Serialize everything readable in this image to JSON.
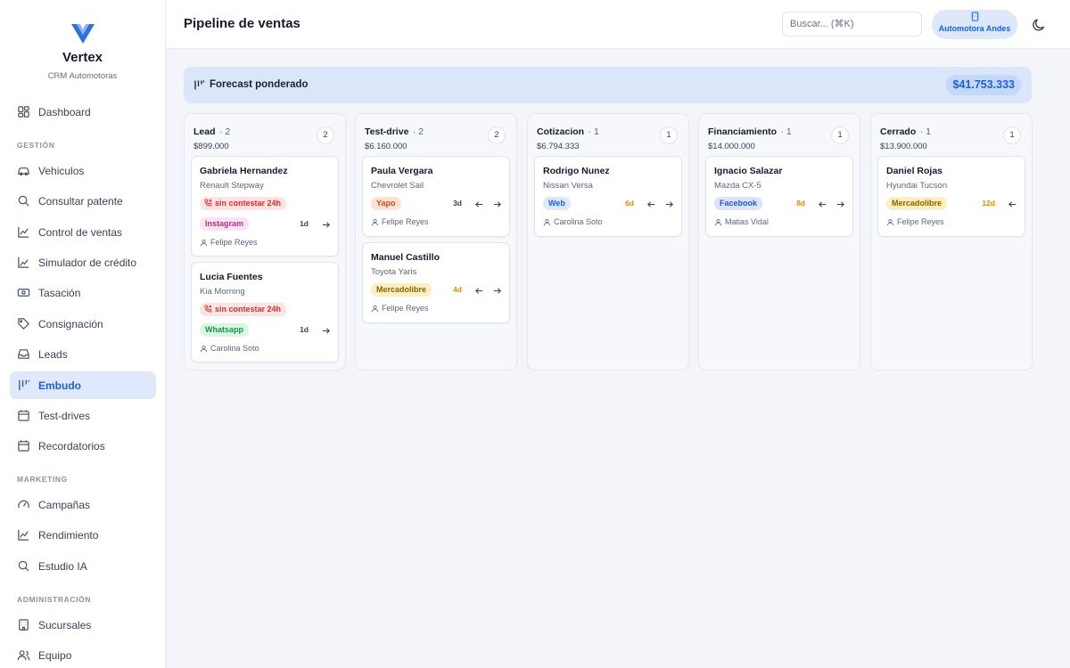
{
  "app": {
    "name": "Vertex",
    "subtitle": "CRM Automotoras",
    "page_title": "Pipeline de ventas",
    "search_placeholder": "Buscar... (⌘K)",
    "org_label": "Automotora Andes",
    "accent_color": "#1e5fd8"
  },
  "sidebar": {
    "dashboard": "Dashboard",
    "sections": {
      "gestion": "GESTIÓN",
      "marketing": "MARKETING",
      "administracion": "ADMINISTRACIÓN"
    },
    "items": {
      "vehiculos": "Vehiculos",
      "consultar_patente": "Consultar patente",
      "control_ventas": "Control de ventas",
      "simulador_credito": "Simulador de crédito",
      "tasacion": "Tasación",
      "consignacion": "Consignación",
      "leads": "Leads",
      "embudo": "Embudo",
      "test_drives": "Test-drives",
      "recordatorios": "Recordatorios",
      "campanas": "Campañas",
      "rendimiento": "Rendimiento",
      "estudio_ia": "Estudio IA",
      "sucursales": "Sucursales",
      "equipo": "Equipo"
    },
    "active_item": "embudo"
  },
  "forecast": {
    "label": "Forecast ponderado",
    "value": "$41.753.333"
  },
  "columns": [
    {
      "name": "Lead",
      "dot_count": "· 2",
      "total": "$899.000",
      "badge": "2",
      "cards": [
        {
          "name": "Gabriela Hernandez",
          "vehicle": "Renault Stepway",
          "warning": "sin contestar 24h",
          "source": "Instagram",
          "days": "1d",
          "owner": "Felipe Reyes"
        },
        {
          "name": "Lucia Fuentes",
          "vehicle": "Kia Morning",
          "warning": "sin contestar 24h",
          "source": "Whatsapp",
          "days": "1d",
          "owner": "Carolina Soto"
        }
      ]
    },
    {
      "name": "Test-drive",
      "dot_count": "· 2",
      "total": "$6.160.000",
      "badge": "2",
      "cards": [
        {
          "name": "Paula Vergara",
          "vehicle": "Chevrolet Sail",
          "source": "Yapo",
          "days": "3d",
          "owner": "Felipe Reyes"
        },
        {
          "name": "Manuel Castillo",
          "vehicle": "Toyota Yaris",
          "source": "Mercadolibre",
          "days": "4d",
          "owner": "Felipe Reyes"
        }
      ]
    },
    {
      "name": "Cotizacion",
      "dot_count": "· 1",
      "total": "$6.794.333",
      "badge": "1",
      "cards": [
        {
          "name": "Rodrigo Nunez",
          "vehicle": "Nissan Versa",
          "source": "Web",
          "days": "6d",
          "owner": "Carolina Soto"
        }
      ]
    },
    {
      "name": "Financiamiento",
      "dot_count": "· 1",
      "total": "$14.000.000",
      "badge": "1",
      "cards": [
        {
          "name": "Ignacio Salazar",
          "vehicle": "Mazda CX-5",
          "source": "Facebook",
          "days": "8d",
          "owner": "Matias Vidal"
        }
      ]
    },
    {
      "name": "Cerrado",
      "dot_count": "· 1",
      "total": "$13.900.000",
      "badge": "1",
      "cards": [
        {
          "name": "Daniel Rojas",
          "vehicle": "Hyundai Tucson",
          "source": "Mercadolibre",
          "days": "12d",
          "owner": "Felipe Reyes"
        }
      ]
    }
  ],
  "source_colors": {
    "Instagram": {
      "bg": "#fbe3f3",
      "fg": "#c0298d"
    },
    "Whatsapp": {
      "bg": "#dcf5e3",
      "fg": "#1f8f46"
    },
    "Yapo": {
      "bg": "#fde3d6",
      "fg": "#c94d1b"
    },
    "Mercadolibre": {
      "bg": "#fcefc2",
      "fg": "#8a6200"
    },
    "Web": {
      "bg": "#dde8fb",
      "fg": "#1e5fd8"
    },
    "Facebook": {
      "bg": "#dbe4fb",
      "fg": "#2b55c4"
    }
  },
  "icons": {
    "warning": "phone-missed-icon",
    "owner": "user-icon",
    "move_prev": "arrow-left-icon",
    "move_next": "arrow-right-icon"
  }
}
